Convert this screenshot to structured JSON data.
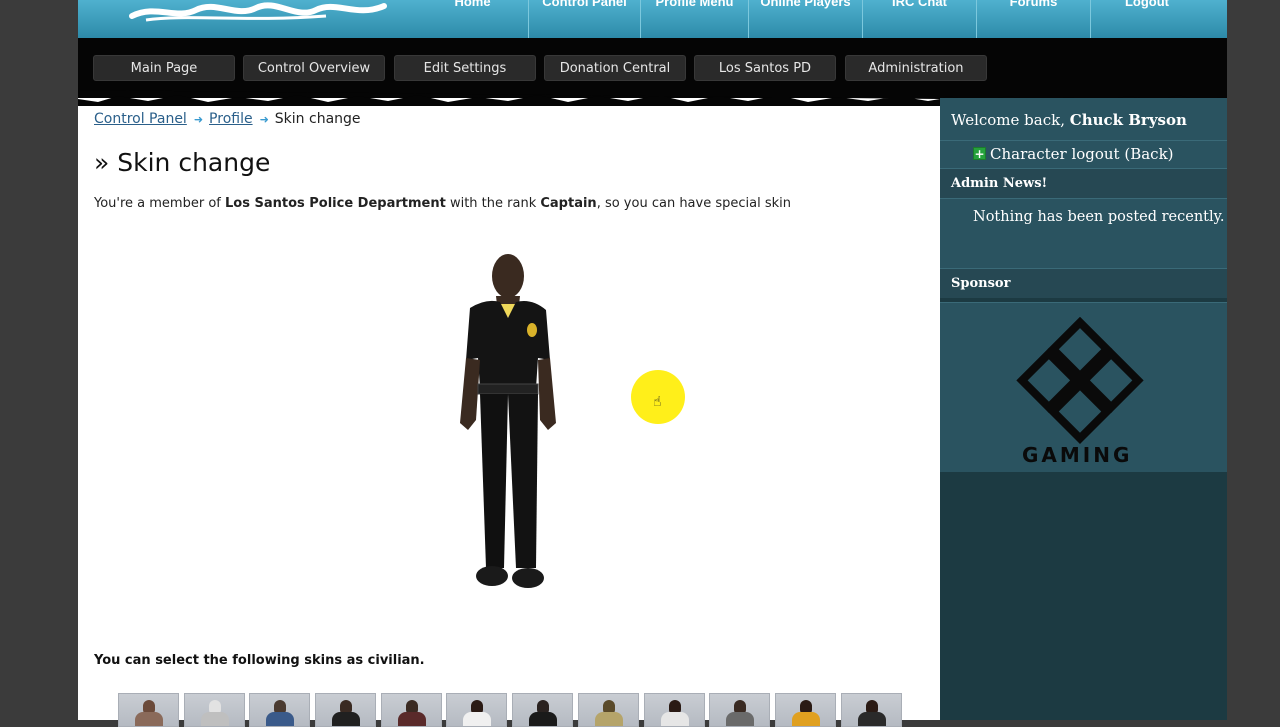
{
  "topnav": {
    "items": [
      "Home",
      "Control Panel",
      "Profile Menu",
      "Online Players",
      "IRC Chat",
      "Forums",
      "Logout"
    ]
  },
  "subnav": {
    "items": [
      "Main Page",
      "Control Overview",
      "Edit Settings",
      "Donation Central",
      "Los Santos PD",
      "Administration"
    ]
  },
  "breadcrumb": {
    "items": [
      "Control Panel",
      "Profile",
      "Skin change"
    ]
  },
  "page": {
    "title": "» Skin change",
    "desc_prefix": "You're a member of ",
    "department": "Los Santos Police Department",
    "desc_mid": " with the rank ",
    "rank": "Captain",
    "desc_suffix": ", so you can have special skin",
    "civilian_text": "You can select the following skins as civilian."
  },
  "sidebar": {
    "welcome_prefix": "Welcome back, ",
    "username": "Chuck Bryson",
    "logout_label": "Character logout (Back)",
    "admin_news_title": "Admin News!",
    "admin_news_text": "Nothing has been posted recently.",
    "sponsor_title": "Sponsor",
    "sponsor_name": "GAMING"
  },
  "colors": {
    "accent": "#2d8aa9",
    "sidebar": "#2a5360",
    "cursor_highlight": "#ffef1a"
  },
  "icons": {
    "breadcrumb_separator": "arrow-right-icon",
    "logout": "plus-icon",
    "cursor": "hand-pointer-icon"
  }
}
